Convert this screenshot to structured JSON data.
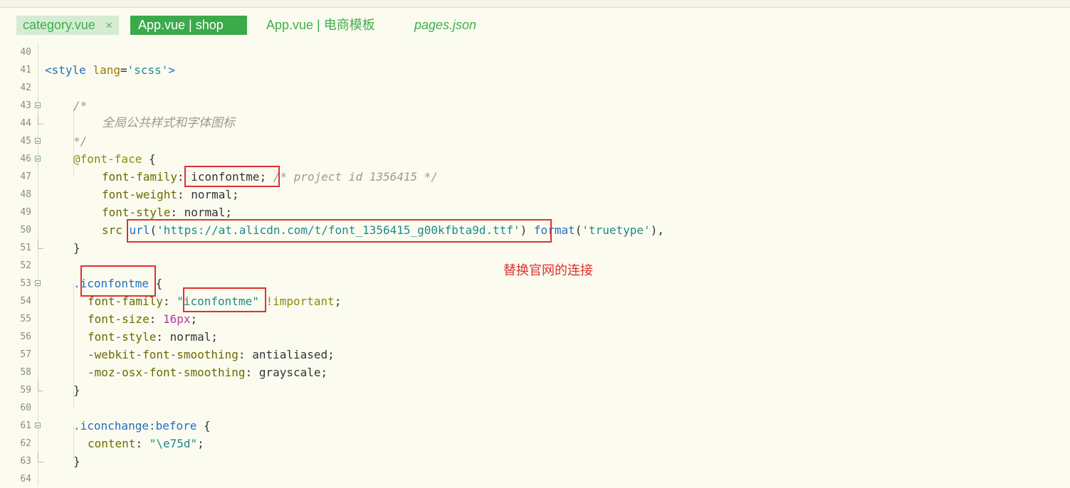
{
  "tabs": [
    {
      "label": "category.vue",
      "close": "×"
    },
    {
      "label": "App.vue | shop"
    },
    {
      "label": "App.vue | 电商模板"
    },
    {
      "label": "pages.json"
    }
  ],
  "lines": [
    {
      "n": "40"
    },
    {
      "n": "41"
    },
    {
      "n": "42"
    },
    {
      "n": "43"
    },
    {
      "n": "44"
    },
    {
      "n": "45"
    },
    {
      "n": "46"
    },
    {
      "n": "47"
    },
    {
      "n": "48"
    },
    {
      "n": "49"
    },
    {
      "n": "50"
    },
    {
      "n": "51"
    },
    {
      "n": "52"
    },
    {
      "n": "53"
    },
    {
      "n": "54"
    },
    {
      "n": "55"
    },
    {
      "n": "56"
    },
    {
      "n": "57"
    },
    {
      "n": "58"
    },
    {
      "n": "59"
    },
    {
      "n": "60"
    },
    {
      "n": "61"
    },
    {
      "n": "62"
    },
    {
      "n": "63"
    },
    {
      "n": "64"
    }
  ],
  "code": {
    "l41": {
      "lt": "<",
      "tag": "style",
      "sp": " ",
      "attr": "lang",
      "eq": "=",
      "str": "'scss'",
      "gt": ">"
    },
    "l43": "/*",
    "l44": "全局公共样式和字体图标",
    "l45": "*/",
    "l46": {
      "at": "@font-face",
      "rest": " {"
    },
    "l47": {
      "prop": "font-family",
      "colon": ": ",
      "val": "iconfontme;",
      "sp": " ",
      "com": "/* project id 1356415 */"
    },
    "l48": {
      "prop": "font-weight",
      "colon": ": ",
      "val": "normal;"
    },
    "l49": {
      "prop": "font-style",
      "colon": ": ",
      "val": "normal;"
    },
    "l50": {
      "prop": "src",
      "sp": " ",
      "fn": "url",
      "p1": "(",
      "str": "'https://at.alicdn.com/t/font_1356415_g00kfbta9d.ttf'",
      "p2": ")",
      "sp2": " ",
      "fn2": "format",
      "p3": "(",
      "str2": "'truetype'",
      "p4": "),"
    },
    "l51": "}",
    "l53": {
      "sel": ".iconfontme",
      "rest": " {"
    },
    "l54": {
      "prop": "font-family",
      "colon": ": ",
      "q1": "\"",
      "str": "iconfontme",
      "q2": "\"",
      "sp": " ",
      "imp": "!important",
      "semi": ";"
    },
    "l55": {
      "prop": "font-size",
      "colon": ": ",
      "num": "16px",
      "semi": ";"
    },
    "l56": {
      "prop": "font-style",
      "colon": ": ",
      "val": "normal;"
    },
    "l57": {
      "prop": "-webkit-font-smoothing",
      "colon": ": ",
      "val": "antialiased;"
    },
    "l58": {
      "prop": "-moz-osx-font-smoothing",
      "colon": ": ",
      "val": "grayscale;"
    },
    "l59": "}",
    "l61": {
      "sel": ".iconchange:before",
      "rest": " {"
    },
    "l62": {
      "prop": "content",
      "colon": ": ",
      "str": "\"\\e75d\"",
      "semi": ";"
    },
    "l63": "}"
  },
  "annotation": "替换官网的连接"
}
